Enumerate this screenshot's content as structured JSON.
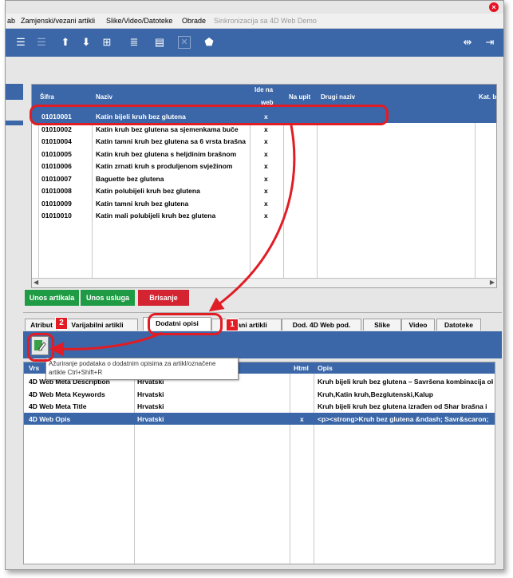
{
  "menu": {
    "items": [
      "ab",
      "Zamjenski/vezani artikli",
      "Slike/Video/Datoteke",
      "Obrade"
    ],
    "sync_label": "Sinkronizacija sa 4D Web Demo"
  },
  "toolbar": {
    "icons": [
      "list-icon",
      "list-disabled-icon",
      "arrow-up-icon",
      "arrow-down-icon",
      "tree-add-icon",
      "list-add-icon",
      "document-icon",
      "delete-icon",
      "tag-icon"
    ],
    "right_icons": [
      "columns-icon",
      "exit-icon"
    ]
  },
  "articles_table": {
    "headers": {
      "sifra": "Šifra",
      "naziv": "Naziv",
      "ide_na_web_1": "Ide na",
      "ide_na_web_2": "web",
      "na_upit": "Na upit",
      "drugi_naziv": "Drugi naziv",
      "kat": "Kat. b"
    },
    "rows": [
      {
        "sifra": "01010001",
        "naziv": "Katin bijeli kruh bez glutena",
        "web": "x",
        "selected": true
      },
      {
        "sifra": "01010002",
        "naziv": "Katin kruh bez glutena sa sjemenkama buče",
        "web": "x"
      },
      {
        "sifra": "01010004",
        "naziv": "Katin tamni kruh bez glutena sa 6 vrsta brašna",
        "web": "x"
      },
      {
        "sifra": "01010005",
        "naziv": "Katin kruh bez glutena s heljdinim brašnom",
        "web": "x"
      },
      {
        "sifra": "01010006",
        "naziv": "Katin zrnati kruh s produljenom svježinom",
        "web": "x"
      },
      {
        "sifra": "01010007",
        "naziv": "Baguette bez glutena",
        "web": "x"
      },
      {
        "sifra": "01010008",
        "naziv": "Katin polubijeli kruh bez glutena",
        "web": "x"
      },
      {
        "sifra": "01010009",
        "naziv": "Katin tamni kruh bez glutena",
        "web": "x"
      },
      {
        "sifra": "01010010",
        "naziv": "Katin mali polubijeli kruh bez glutena",
        "web": "x"
      }
    ]
  },
  "buttons": {
    "unos_artikala": "Unos artikala",
    "unos_usluga": "Unos usluga",
    "brisanje": "Brisanje"
  },
  "tabs": [
    "Atribut",
    "Varijabilni artikli",
    "Dodatni opisi",
    "Vezani artikli",
    "Dod. 4D Web pod.",
    "Slike",
    "Video",
    "Datoteke"
  ],
  "tooltip": {
    "line1": "Ažuriranje podataka o dodatnim opisima za artikl/označene",
    "line2": "artikle    Ctrl+Shift+R"
  },
  "desc_table": {
    "headers": {
      "vrsta": "Vrs",
      "jezik": "",
      "html": "Html",
      "opis": "Opis"
    },
    "rows": [
      {
        "vrsta": "4D Web Meta Description",
        "jezik": "Hrvatski",
        "html": "",
        "opis": "Kruh bijeli kruh bez glutena – Savršena kombinacija okusa"
      },
      {
        "vrsta": "4D Web Meta Keywords",
        "jezik": "Hrvatski",
        "html": "",
        "opis": "Kruh,Katin kruh,Bezglutenski,Kalup"
      },
      {
        "vrsta": "4D Web Meta Title",
        "jezik": "Hrvatski",
        "html": "",
        "opis": "Kruh bijeli kruh bez glutena izrađen od Shar brašna i"
      },
      {
        "vrsta": "4D Web Opis",
        "jezik": "Hrvatski",
        "html": "x",
        "opis": "<p><strong>Kruh bez glutena &ndash; Savr&scaron;",
        "selected": true
      }
    ]
  },
  "annotations": {
    "badge_1": "1",
    "badge_2": "2"
  },
  "colors": {
    "toolbar_blue": "#3b67a8",
    "accent_red": "#e11c24",
    "button_green": "#1f9b45",
    "button_red": "#d42431"
  }
}
